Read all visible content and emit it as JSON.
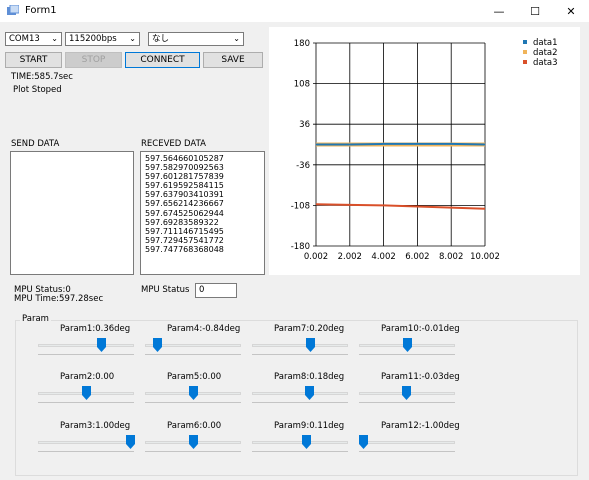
{
  "window": {
    "title": "Form1",
    "buttons": [
      "—",
      "☐",
      "✕"
    ]
  },
  "toolbar": {
    "port": "COM13",
    "baud": "115200bps",
    "mode": "なし",
    "start_label": "START",
    "stop_label": "STOP",
    "connect_label": "CONNECT",
    "save_label": "SAVE"
  },
  "status": {
    "time": "TIME:585.7sec",
    "plot": "Plot Stoped",
    "mpu_status": "MPU Status:0",
    "mpu_time": "MPU Time:597.28sec",
    "mpu_status_label": "MPU Status",
    "mpu_status_value": "0"
  },
  "send": {
    "label": "SEND DATA"
  },
  "recv": {
    "label": "RECEVED DATA",
    "lines": [
      "597.564660105287",
      "597.582970092563",
      "597.601281757839",
      "597.619592584115",
      "597.637903410391",
      "597.656214236667",
      "597.674525062944",
      "597.69283589322",
      "597.711146715495",
      "597.729457541772",
      "597.747768368048"
    ]
  },
  "params": {
    "group_label": "Param",
    "items": [
      {
        "label": "Param1:0.36deg",
        "level": 0.66
      },
      {
        "label": "Param4:-0.84deg",
        "level": 0.12
      },
      {
        "label": "Param7:0.20deg",
        "level": 0.6
      },
      {
        "label": "Param10:-0.01deg",
        "level": 0.5
      },
      {
        "label": "Param2:0.00",
        "level": 0.5
      },
      {
        "label": "Param5:0.00",
        "level": 0.5
      },
      {
        "label": "Param8:0.18deg",
        "level": 0.59
      },
      {
        "label": "Param11:-0.03deg",
        "level": 0.49
      },
      {
        "label": "Param3:1.00deg",
        "level": 0.96
      },
      {
        "label": "Param6:0.00",
        "level": 0.5
      },
      {
        "label": "Param9:0.11deg",
        "level": 0.56
      },
      {
        "label": "Param12:-1.00deg",
        "level": 0.04
      }
    ]
  },
  "colors": {
    "data1": "#1f77b4",
    "data2": "#f0b45a",
    "data3": "#d9502a",
    "slider_thumb": "#0078d7"
  },
  "chart_data": {
    "type": "line",
    "title": "",
    "xlabel": "",
    "ylabel": "",
    "xlim": [
      0.002,
      10.002
    ],
    "ylim": [
      -180,
      180
    ],
    "xticks": [
      "0.002",
      "2.002",
      "4.002",
      "6.002",
      "8.002",
      "10.002"
    ],
    "yticks": [
      "180",
      "108",
      "36",
      "-36",
      "-108",
      "-180"
    ],
    "grid": true,
    "legend": "top-right",
    "series": [
      {
        "name": "data1",
        "x": [
          0.002,
          2.002,
          4.002,
          6.002,
          8.002,
          10.002
        ],
        "values": [
          0,
          0,
          1,
          1,
          1,
          0
        ]
      },
      {
        "name": "data2",
        "x": [
          0.002,
          2.002,
          4.002,
          6.002,
          8.002,
          10.002
        ],
        "values": [
          0,
          0,
          0,
          0,
          0,
          0
        ]
      },
      {
        "name": "data3",
        "x": [
          0.002,
          2.002,
          4.002,
          6.002,
          8.002,
          10.002
        ],
        "values": [
          -106,
          -107,
          -108,
          -110,
          -112,
          -114
        ]
      }
    ]
  }
}
